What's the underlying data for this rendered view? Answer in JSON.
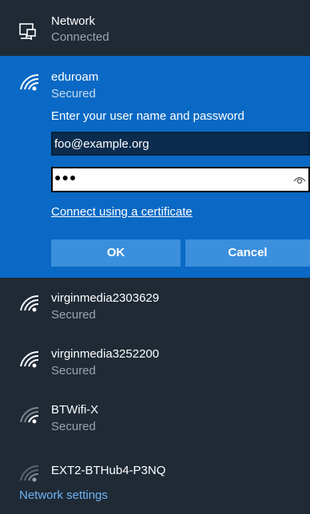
{
  "wired": {
    "name": "Network",
    "status": "Connected",
    "icon": "ethernet-icon"
  },
  "selected_network": {
    "name": "eduroam",
    "status": "Secured",
    "icon": "wifi-secured-icon",
    "prompt": "Enter your user name and password",
    "username_value": "foo@example.org",
    "password_masked": "●●●",
    "reveal_icon": "eye-icon",
    "certificate_link": "Connect using a certificate",
    "ok_label": "OK",
    "cancel_label": "Cancel"
  },
  "networks": [
    {
      "name": "virginmedia2303629",
      "status": "Secured",
      "icon": "wifi-secured-icon"
    },
    {
      "name": "virginmedia3252200",
      "status": "Secured",
      "icon": "wifi-secured-icon"
    },
    {
      "name": "BTWifi-X",
      "status": "Secured",
      "icon": "wifi-secured-icon"
    },
    {
      "name": "EXT2-BTHub4-P3NQ",
      "status": "",
      "icon": "wifi-icon"
    }
  ],
  "footer": {
    "settings_link": "Network settings"
  },
  "colors": {
    "background": "#1f2a35",
    "selected_background": "#0a69c4",
    "button": "#3b8fdc",
    "link": "#6fb3f5",
    "secondary_text": "#9aa4ae"
  }
}
